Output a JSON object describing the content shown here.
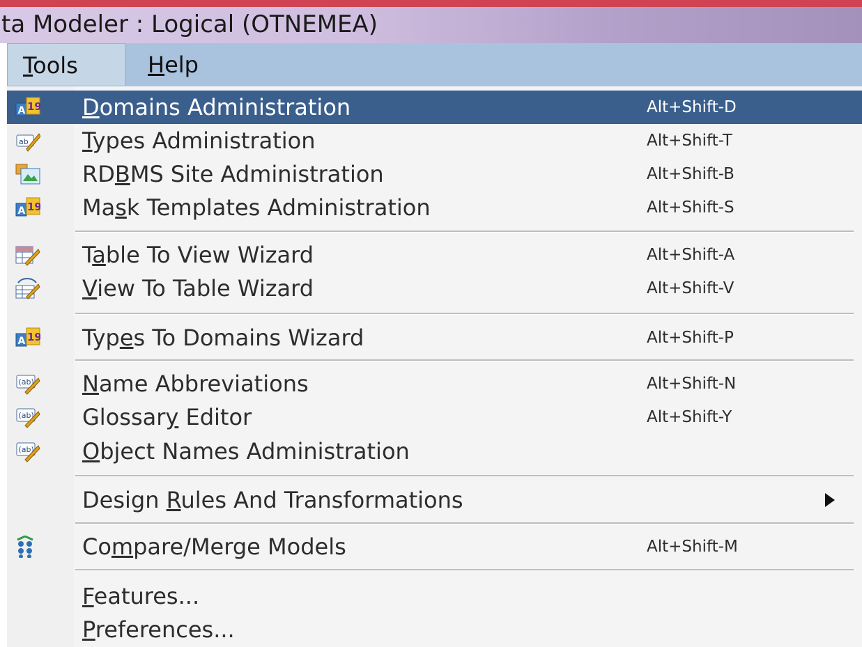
{
  "window": {
    "title": "ta Modeler : Logical (OTNEMEA)"
  },
  "menubar": {
    "items": [
      {
        "label": "Tools",
        "mnemonic": "T",
        "active": true
      },
      {
        "label": "Help",
        "mnemonic": "H",
        "active": false
      }
    ]
  },
  "tools_menu": {
    "groups": [
      [
        {
          "label": "Domains Administration",
          "mnemonic": "D",
          "shortcut": "Alt+Shift-D",
          "icon": "domains-icon",
          "highlighted": true
        },
        {
          "label": "Types Administration",
          "mnemonic": "T",
          "shortcut": "Alt+Shift-T",
          "icon": "types-icon"
        },
        {
          "label": "RDBMS Site Administration",
          "mnemonic": "B",
          "shortcut": "Alt+Shift-B",
          "icon": "rdbms-site-icon"
        },
        {
          "label": "Mask Templates Administration",
          "mnemonic": "s",
          "shortcut": "Alt+Shift-S",
          "icon": "mask-templates-icon"
        }
      ],
      [
        {
          "label": "Table To View Wizard",
          "mnemonic": "a",
          "shortcut": "Alt+Shift-A",
          "icon": "table-to-view-icon"
        },
        {
          "label": "View To Table Wizard",
          "mnemonic": "V",
          "shortcut": "Alt+Shift-V",
          "icon": "view-to-table-icon"
        }
      ],
      [
        {
          "label": "Types To Domains Wizard",
          "mnemonic": "e",
          "shortcut": "Alt+Shift-P",
          "icon": "types-to-domains-icon"
        }
      ],
      [
        {
          "label": "Name Abbreviations",
          "mnemonic": "N",
          "shortcut": "Alt+Shift-N",
          "icon": "name-abbreviations-icon"
        },
        {
          "label": "Glossary Editor",
          "mnemonic": "y",
          "shortcut": "Alt+Shift-Y",
          "icon": "glossary-editor-icon"
        },
        {
          "label": "Object Names Administration",
          "mnemonic": "O",
          "shortcut": "",
          "icon": "object-names-icon"
        }
      ],
      [
        {
          "label": "Design Rules And Transformations",
          "mnemonic": "R",
          "shortcut": "",
          "icon": "",
          "submenu": true
        }
      ],
      [
        {
          "label": "Compare/Merge Models",
          "mnemonic": "m",
          "shortcut": "Alt+Shift-M",
          "icon": "compare-merge-icon"
        }
      ],
      [
        {
          "label": "Features...",
          "mnemonic": "F",
          "shortcut": "",
          "icon": ""
        },
        {
          "label": "Preferences...",
          "mnemonic": "P",
          "shortcut": "",
          "icon": ""
        }
      ]
    ]
  },
  "colors": {
    "highlight": "#3b5f8d",
    "menubar": "#a9c3de",
    "accent": "#cf4353"
  }
}
